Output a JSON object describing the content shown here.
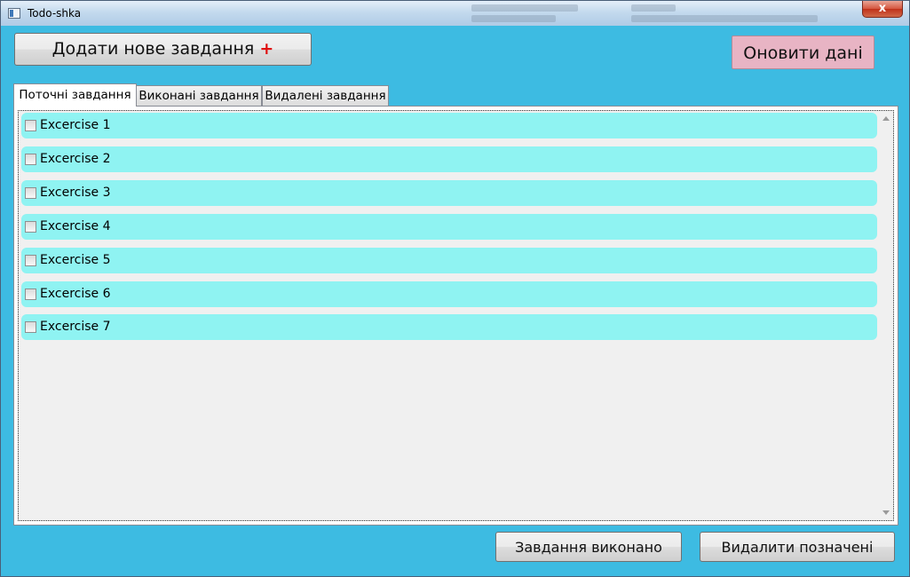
{
  "window": {
    "title": "Todo-shka",
    "close_label": "x"
  },
  "toolbar": {
    "add_label": "Додати нове завдання",
    "add_plus": "+",
    "refresh_label": "Оновити дані"
  },
  "tabs": [
    {
      "label": "Поточні завдання",
      "active": true
    },
    {
      "label": "Виконані завдання",
      "active": false
    },
    {
      "label": "Видалені завдання",
      "active": false
    }
  ],
  "tasks": [
    {
      "label": "Excercise 1",
      "checked": false
    },
    {
      "label": "Excercise 2",
      "checked": false
    },
    {
      "label": "Excercise 3",
      "checked": false
    },
    {
      "label": "Excercise 4",
      "checked": false
    },
    {
      "label": "Excercise 5",
      "checked": false
    },
    {
      "label": "Excercise 6",
      "checked": false
    },
    {
      "label": "Excercise 7",
      "checked": false
    }
  ],
  "footer": {
    "done_label": "Завдання виконано",
    "delete_label": "Видалити позначені"
  },
  "colors": {
    "window_bg": "#3dbbe2",
    "task_bg": "#8ff3f2",
    "refresh_bg": "#e8b4c4",
    "plus_color": "#e01010"
  }
}
